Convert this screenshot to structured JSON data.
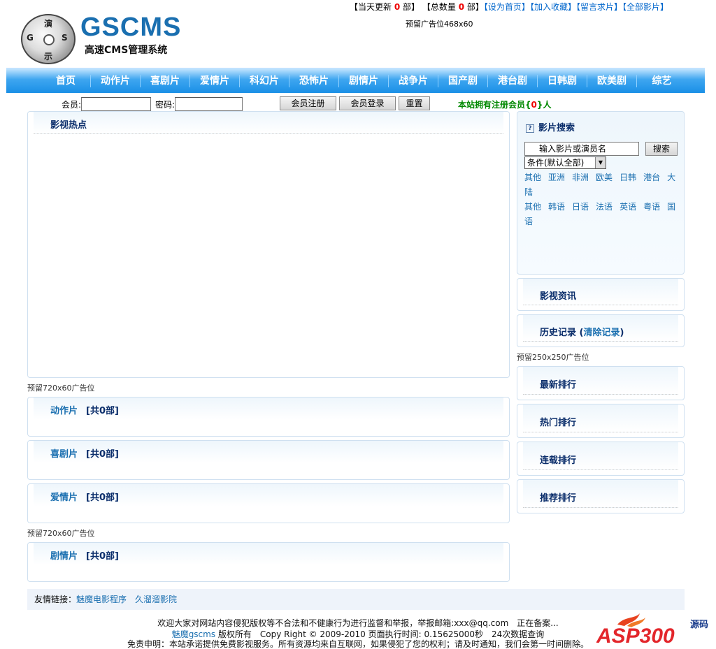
{
  "top": {
    "today_label_pre": "【当天更新",
    "today_count": "0",
    "today_label_post": "部】",
    "total_label_pre": "【总数量",
    "total_count": "0",
    "total_label_post": "部】",
    "links": [
      "【设为首页】",
      "【加入收藏】",
      "【留言求片】",
      "【全部影片】"
    ],
    "ad_468": "预留广告位468x60"
  },
  "logo": {
    "title": "GSCMS",
    "subtitle": "高速CMS管理系统",
    "disc_chars": [
      "演",
      "G",
      "S",
      "示"
    ]
  },
  "nav": [
    "首页",
    "动作片",
    "喜剧片",
    "爱情片",
    "科幻片",
    "恐怖片",
    "剧情片",
    "战争片",
    "国产剧",
    "港台剧",
    "日韩剧",
    "欧美剧",
    "综艺"
  ],
  "login": {
    "member_label": "会员:",
    "password_label": "密码:",
    "register_btn": "会员注册",
    "login_btn": "会员登录",
    "reset_btn": "重置",
    "registered_pre": "本站拥有注册会员{",
    "registered_count": "0",
    "registered_post": "}人"
  },
  "main": {
    "hot_title": "影视热点",
    "ad_720": "预留720x60广告位",
    "categories": [
      {
        "name": "动作片",
        "count": "[共0部]"
      },
      {
        "name": "喜剧片",
        "count": "[共0部]"
      },
      {
        "name": "爱情片",
        "count": "[共0部]"
      },
      {
        "name": "剧情片",
        "count": "[共0部]"
      }
    ]
  },
  "sidebar": {
    "search_title": "影片搜索",
    "search_placeholder": "输入影片或演员名",
    "search_btn": "搜索",
    "condition": "条件(默认全部)",
    "regions": [
      "其他",
      "亚洲",
      "非洲",
      "欧美",
      "日韩",
      "港台",
      "大陆"
    ],
    "languages": [
      "其他",
      "韩语",
      "日语",
      "法语",
      "英语",
      "粤语",
      "国语"
    ],
    "news_title": "影视资讯",
    "history_title": "历史记录",
    "history_clear": "清除记录",
    "ad_250": "预留250x250广告位",
    "rank_titles": [
      "最新排行",
      "热门排行",
      "连载排行",
      "推荐排行"
    ]
  },
  "footer": {
    "friend_label": "友情链接：",
    "friend_links": [
      "魅魔电影程序",
      "久溜溜影院"
    ],
    "line1": "欢迎大家对网站内容侵犯版权等不合法和不健康行为进行监督和举报，举报邮箱:xxx@qq.com　正在备案...",
    "line2_link": "魅魔gscms",
    "line2_text": " 版权所有　Copy Right © 2009-2010 页面执行时间: 0.15625000秒　24次数据查询",
    "line3": "免责申明：本站承诺提供免费影视服务。所有资源均来自互联网，如果侵犯了您的权利；请及时通知，我们会第一时间删除。",
    "watermark_main": "ASP300",
    "watermark_side": "源码"
  }
}
